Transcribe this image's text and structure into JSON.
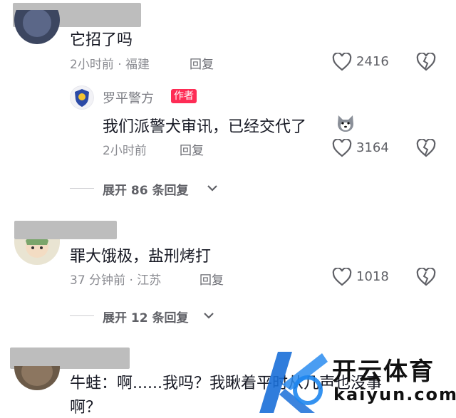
{
  "comments": [
    {
      "text": "它招了吗",
      "meta": "2小时前 · 福建",
      "reply_label": "回复",
      "likes": "2416",
      "author_reply": {
        "name": "罗平警方",
        "tag": "作者",
        "text": "我们派警犬审讯，已经交代了",
        "meta": "2小时前",
        "reply_label": "回复",
        "likes": "3164"
      },
      "expand_label": "展开 86 条回复"
    },
    {
      "text": "罪大饿极，盐刑烤打",
      "meta": "37 分钟前 · 江苏",
      "reply_label": "回复",
      "likes": "1018",
      "expand_label": "展开 12 条回复"
    },
    {
      "text_line1": "牛蛙：啊......我吗？我瞅着平时从几声也没事",
      "text_line2": "啊？"
    }
  ],
  "watermark": {
    "brand_cn": "开云体育",
    "brand_url": "kaiyun.com"
  },
  "colors": {
    "author_tag_bg": "#fe2c55",
    "meta_text": "#8a8b91",
    "main_text": "#161823"
  },
  "icons": [
    "heart-icon",
    "dislike-heart-icon",
    "chevron-down-icon",
    "police-badge-icon",
    "dog-emoji-icon"
  ]
}
